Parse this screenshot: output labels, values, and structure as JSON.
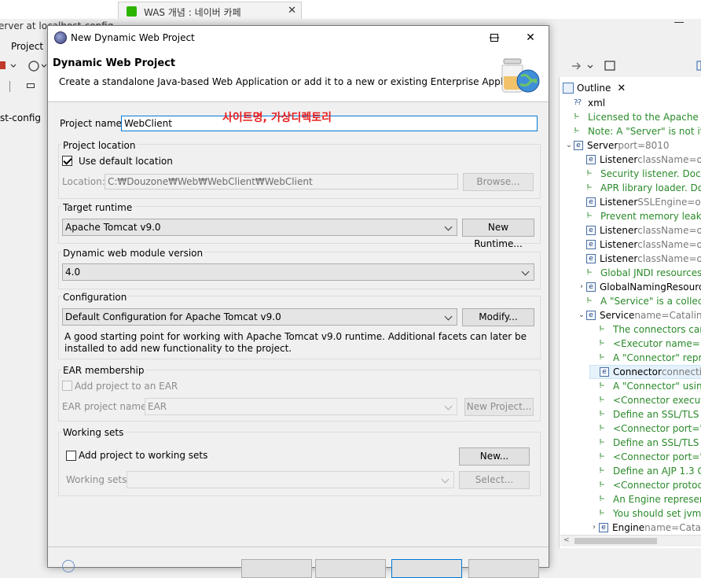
{
  "background": {
    "browser_tab_title": "WAS 개념 : 네이버 카페",
    "ide_title": "erver at localhost-config",
    "menu_project": "Project",
    "left_label": "st-config",
    "outline": {
      "tab_label": "Outline",
      "rows": [
        {
          "kind": "xml",
          "label": "xml",
          "attr": ""
        },
        {
          "kind": "comment",
          "label": "Licensed to the Apache Sc",
          "attr": ""
        },
        {
          "kind": "comment",
          "label": "Note:  A \"Server\" is not its",
          "attr": ""
        },
        {
          "kind": "element",
          "label": "Server",
          "attr": "port=8010"
        },
        {
          "kind": "element",
          "label": "Listener",
          "attr": "className=org"
        },
        {
          "kind": "comment",
          "label": "Security listener. Docu",
          "attr": ""
        },
        {
          "kind": "comment",
          "label": "APR library loader. Doc",
          "attr": ""
        },
        {
          "kind": "element",
          "label": "Listener",
          "attr": "SSLEngine=on"
        },
        {
          "kind": "comment",
          "label": "Prevent memory leaks",
          "attr": ""
        },
        {
          "kind": "element",
          "label": "Listener",
          "attr": "className=org"
        },
        {
          "kind": "element",
          "label": "Listener",
          "attr": "className=org"
        },
        {
          "kind": "element",
          "label": "Listener",
          "attr": "className=org"
        },
        {
          "kind": "comment",
          "label": "Global JNDI resources.",
          "attr": ""
        },
        {
          "kind": "element",
          "label": "GlobalNamingResource",
          "attr": ""
        },
        {
          "kind": "comment",
          "label": "A \"Service\" is a collecti",
          "attr": ""
        },
        {
          "kind": "element",
          "label": "Service",
          "attr": "name=Catalina"
        },
        {
          "kind": "comment",
          "label": "The connectors can",
          "attr": ""
        },
        {
          "kind": "comment",
          "label": "<Executor name=\"to",
          "attr": ""
        },
        {
          "kind": "comment",
          "label": "A \"Connector\" repre",
          "attr": ""
        },
        {
          "kind": "element",
          "label": "Connector",
          "attr": "connectio"
        },
        {
          "kind": "comment",
          "label": "A \"Connector\" using",
          "attr": ""
        },
        {
          "kind": "comment",
          "label": "<Connector executo",
          "attr": ""
        },
        {
          "kind": "comment",
          "label": "Define an SSL/TLS H",
          "attr": ""
        },
        {
          "kind": "comment",
          "label": "<Connector port=\"8",
          "attr": ""
        },
        {
          "kind": "comment",
          "label": "Define an SSL/TLS H",
          "attr": ""
        },
        {
          "kind": "comment",
          "label": "<Connector port=\"8",
          "attr": ""
        },
        {
          "kind": "comment",
          "label": "Define an AJP 1.3 C",
          "attr": ""
        },
        {
          "kind": "comment",
          "label": "<Connector protoco",
          "attr": ""
        },
        {
          "kind": "comment",
          "label": "An Engine represent",
          "attr": ""
        },
        {
          "kind": "comment",
          "label": "You should set jvmR",
          "attr": ""
        },
        {
          "kind": "element",
          "label": "Engine",
          "attr": "name=Catali"
        }
      ]
    }
  },
  "dialog": {
    "title": "New Dynamic Web Project",
    "header_title": "Dynamic Web Project",
    "header_desc": "Create a standalone Java-based Web Application or add it to a new or existing Enterprise Application.",
    "project_name_label": "Project name:",
    "project_name_value": "WebClient",
    "annotation": "사이트명, 가상디렉토리",
    "project_location": {
      "title": "Project location",
      "use_default_label": "Use default location",
      "location_label": "Location:",
      "location_value": "C:₩Douzone₩Web₩WebClient₩WebClient",
      "browse_label": "Browse..."
    },
    "target_runtime": {
      "title": "Target runtime",
      "selected": "Apache Tomcat v9.0",
      "new_runtime_label": "New Runtime..."
    },
    "module_version": {
      "title": "Dynamic web module version",
      "selected": "4.0"
    },
    "configuration": {
      "title": "Configuration",
      "selected": "Default Configuration for Apache Tomcat v9.0",
      "modify_label": "Modify...",
      "description": "A good starting point for working with Apache Tomcat v9.0 runtime. Additional facets can later be installed to add new functionality to the project."
    },
    "ear": {
      "title": "EAR membership",
      "add_label": "Add project to an EAR",
      "ear_name_label": "EAR project name:",
      "ear_name_value": "EAR",
      "new_project_label": "New Project..."
    },
    "working_sets": {
      "title": "Working sets",
      "add_label": "Add project to working sets",
      "new_label": "New...",
      "sets_label": "Working sets:",
      "select_label": "Select..."
    }
  }
}
